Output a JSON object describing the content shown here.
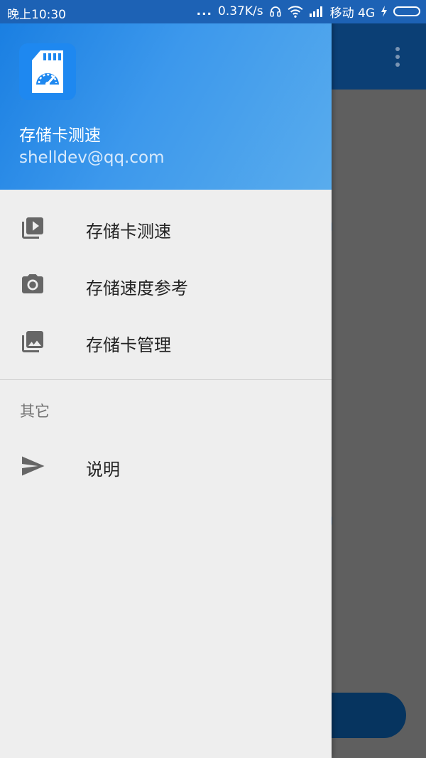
{
  "status_bar": {
    "time": "晚上10:30",
    "dots": "...",
    "speed": "0.37K/s",
    "carrier": "移动 4G",
    "headset_icon": "headset-icon",
    "wifi_icon": "wifi-icon",
    "signal_icon": "signal-icon",
    "charging_icon": "charging-bolt-icon",
    "battery_icon": "battery-icon"
  },
  "drawer": {
    "header": {
      "app_icon": "sd-card-speedometer-icon",
      "title": "存储卡测速",
      "subtitle": "shelldev@qq.com"
    },
    "items": [
      {
        "icon": "video-library-icon",
        "label": "存储卡测速"
      },
      {
        "icon": "camera-icon",
        "label": "存储速度参考"
      },
      {
        "icon": "photo-library-icon",
        "label": "存储卡管理"
      }
    ],
    "section_label": "其它",
    "other_items": [
      {
        "icon": "send-icon",
        "label": "说明"
      }
    ]
  },
  "colors": {
    "header_gradient_start": "#1a7fe2",
    "header_gradient_end": "#59aced",
    "status_bar": "#1d62b5",
    "app_bar_dimmed": "#0b3f75",
    "drawer_background": "#eeeeee",
    "icon_gray": "#666666"
  }
}
